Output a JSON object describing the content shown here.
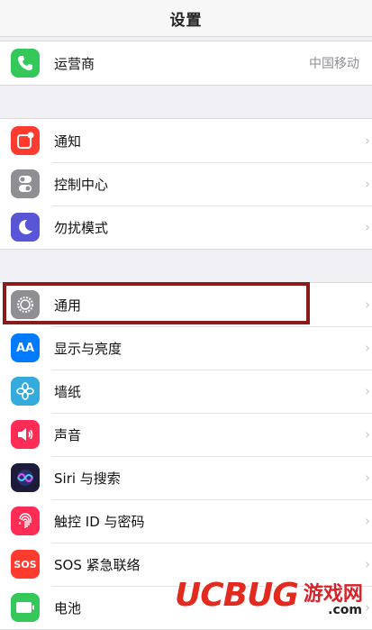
{
  "nav": {
    "title": "设置"
  },
  "group1": [
    {
      "label": "运营商",
      "value": "中国移动",
      "color": "#34c759",
      "icon": "phone-icon"
    }
  ],
  "group2": [
    {
      "label": "通知",
      "color": "#ff3b30",
      "icon": "notifications-icon"
    },
    {
      "label": "控制中心",
      "color": "#8e8e93",
      "icon": "control-center-icon"
    },
    {
      "label": "勿扰模式",
      "color": "#5856d6",
      "icon": "moon-icon"
    }
  ],
  "group3": [
    {
      "label": "通用",
      "color": "#8e8e93",
      "icon": "gear-icon"
    },
    {
      "label": "显示与亮度",
      "color": "#007aff",
      "icon": "display-brightness-icon",
      "glyph": "AA"
    },
    {
      "label": "墙纸",
      "color": "#35aadc",
      "icon": "wallpaper-icon"
    },
    {
      "label": "声音",
      "color": "#ff2d55",
      "icon": "sound-icon"
    },
    {
      "label": "Siri 与搜索",
      "color": "#1c1c3a",
      "icon": "siri-icon"
    },
    {
      "label": "触控 ID 与密码",
      "color": "#ff2d55",
      "icon": "fingerprint-icon"
    },
    {
      "label": "SOS 紧急联络",
      "color": "#ff3b30",
      "icon": "sos-icon",
      "glyph": "SOS"
    },
    {
      "label": "电池",
      "color": "#34c759",
      "icon": "battery-icon"
    }
  ],
  "watermark": {
    "brand": "UCBUG",
    "cn": "游戏网",
    "domain": ".com"
  }
}
